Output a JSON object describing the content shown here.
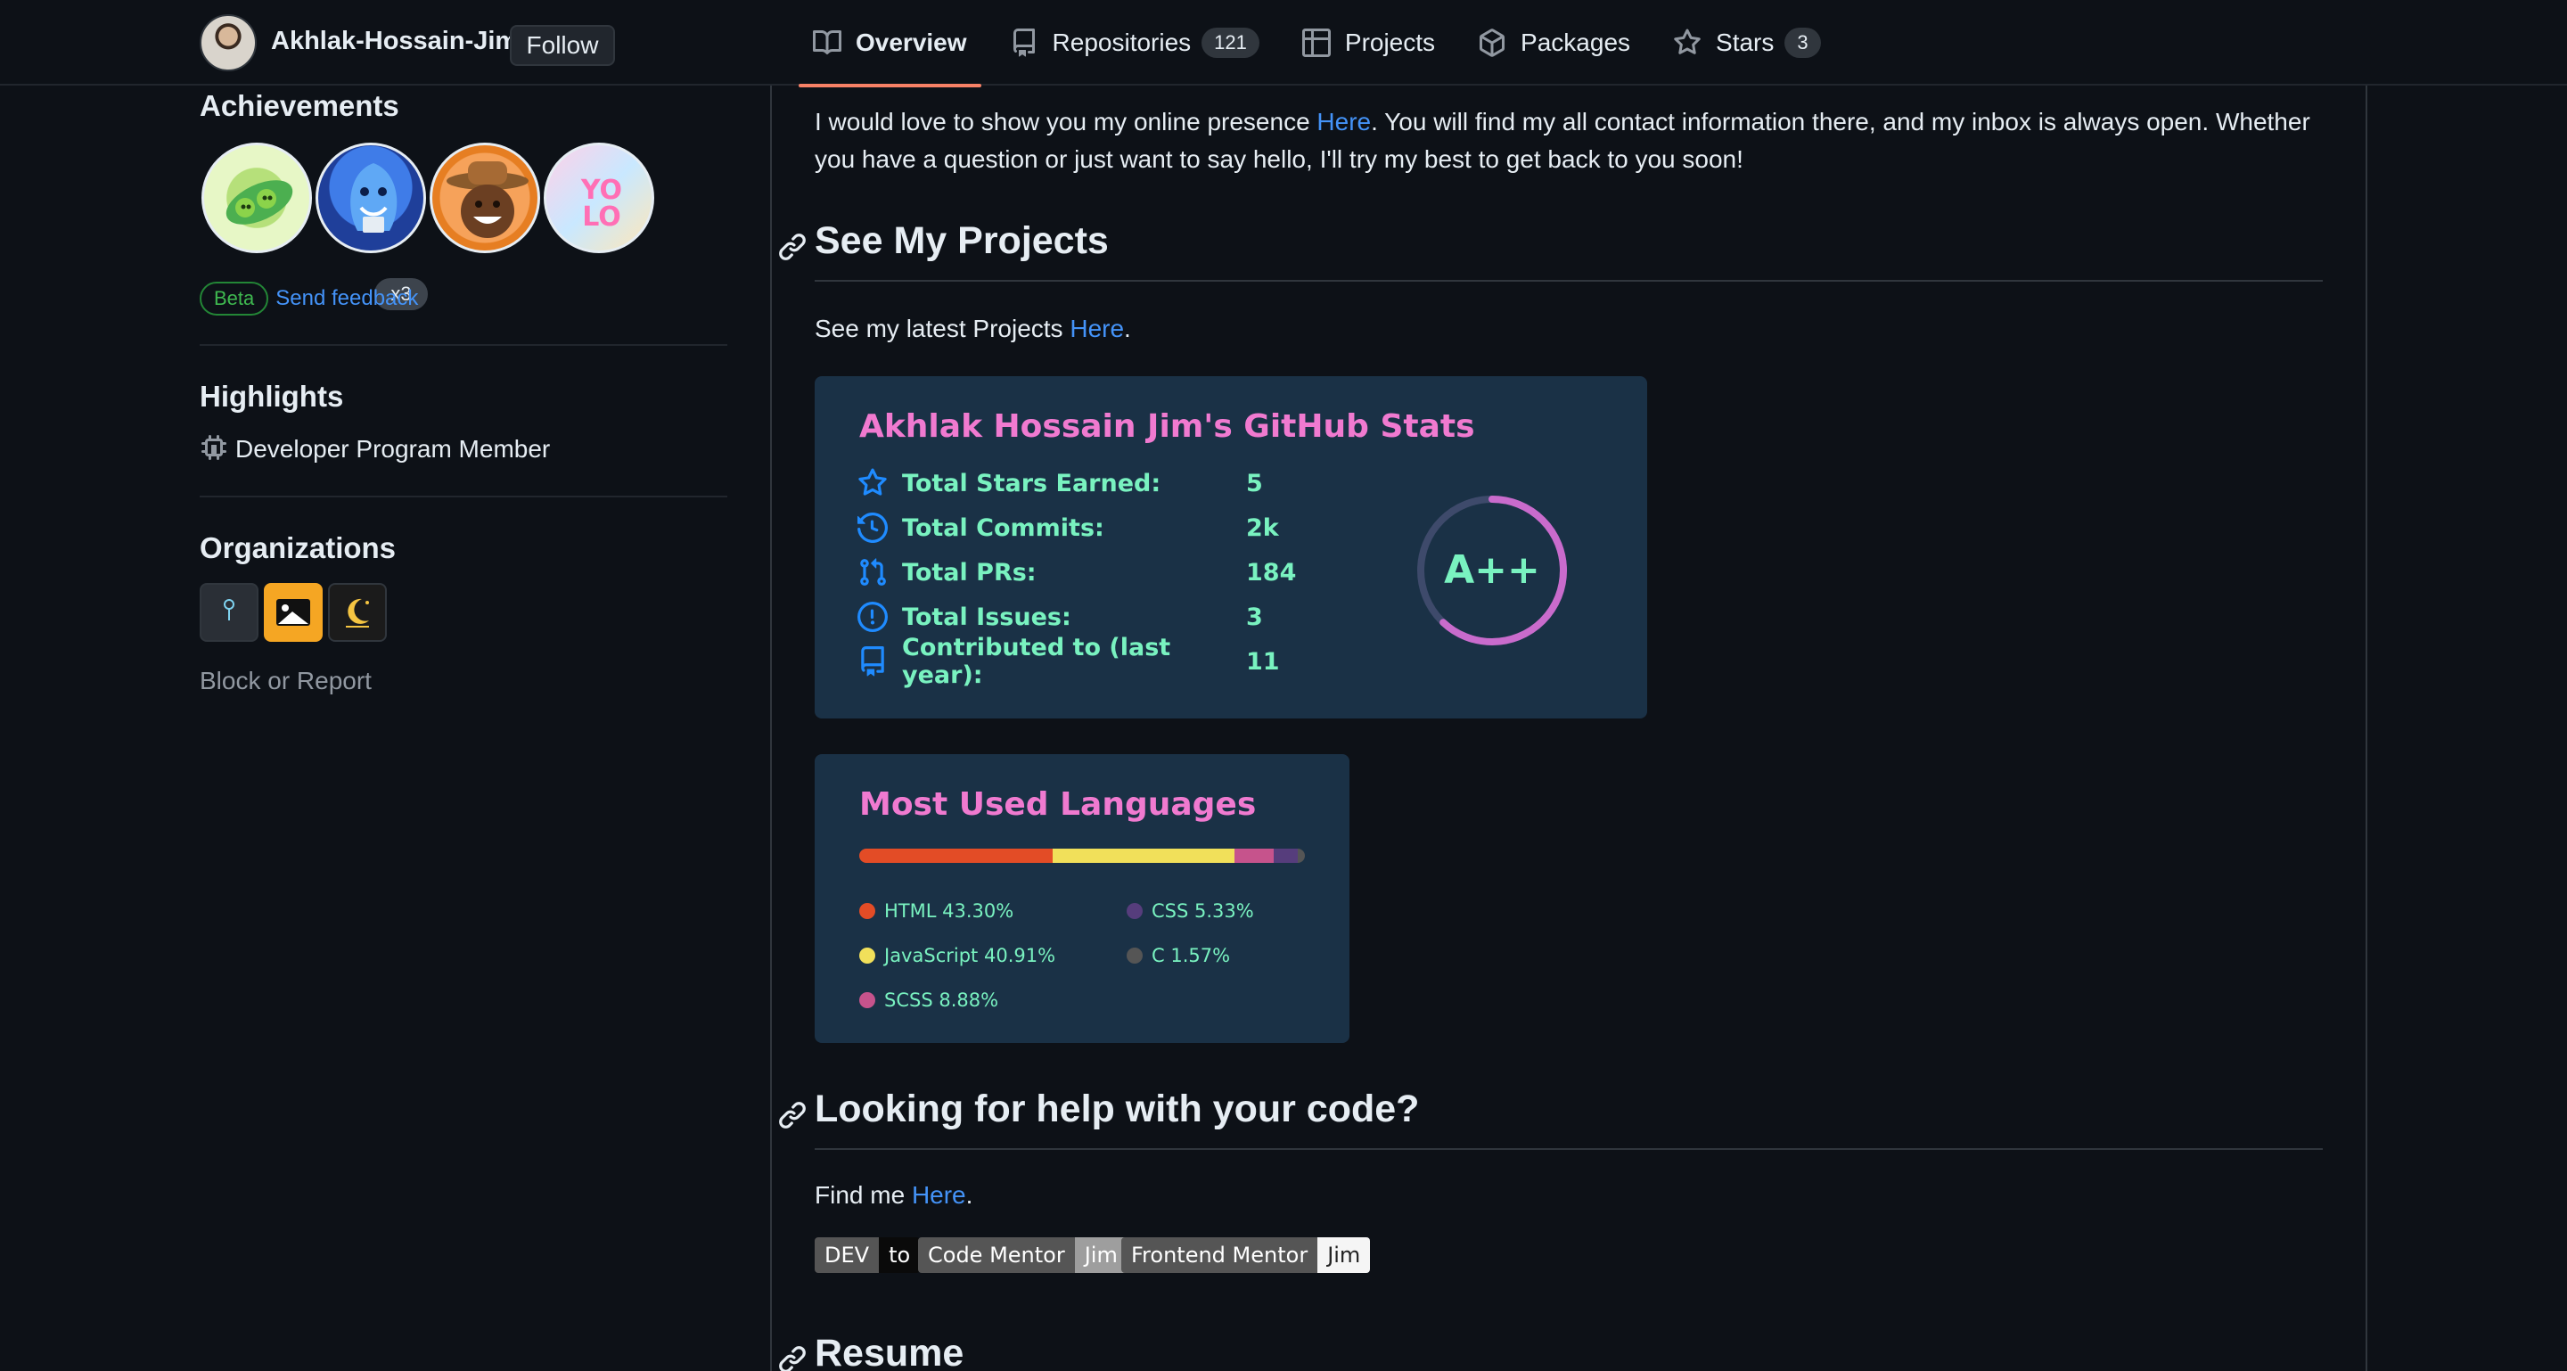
{
  "header": {
    "username": "Akhlak-Hossain-Jim",
    "follow_label": "Follow",
    "tabs": [
      {
        "label": "Overview",
        "icon": "book-icon",
        "active": true
      },
      {
        "label": "Repositories",
        "icon": "repo-icon",
        "count": "121"
      },
      {
        "label": "Projects",
        "icon": "table-icon"
      },
      {
        "label": "Packages",
        "icon": "package-icon"
      },
      {
        "label": "Stars",
        "icon": "star-icon",
        "count": "3"
      }
    ]
  },
  "sidebar": {
    "achievements_title": "Achievements",
    "achievement_multiplier": "x3",
    "beta_label": "Beta",
    "feedback_label": "Send feedback",
    "highlights_title": "Highlights",
    "highlight_item": "Developer Program Member",
    "organizations_title": "Organizations",
    "block_report": "Block or Report"
  },
  "main": {
    "intro_before": "I would love to show you my online presence ",
    "intro_link": "Here",
    "intro_after": ". You will find my all contact information there, and my inbox is always open. Whether you have a question or just want to say hello, I'll try my best to get back to you soon!",
    "projects_heading": "See My Projects",
    "projects_before": "See my latest Projects ",
    "projects_link": "Here",
    "projects_after": ".",
    "stats": {
      "title": "Akhlak Hossain Jim's GitHub Stats",
      "rows": [
        {
          "label": "Total Stars Earned:",
          "value": "5",
          "icon": "star-icon"
        },
        {
          "label": "Total Commits:",
          "value": "2k",
          "icon": "history-icon"
        },
        {
          "label": "Total PRs:",
          "value": "184",
          "icon": "pull-request-icon"
        },
        {
          "label": "Total Issues:",
          "value": "3",
          "icon": "issue-icon"
        },
        {
          "label": "Contributed to (last year):",
          "value": "11",
          "icon": "repo-icon"
        }
      ],
      "grade": "A++",
      "grade_progress": 0.62
    },
    "languages": {
      "title": "Most Used Languages",
      "items": [
        {
          "name": "HTML",
          "percent": "43.30%",
          "value": 43.3,
          "color": "#e34c26"
        },
        {
          "name": "JavaScript",
          "percent": "40.91%",
          "value": 40.91,
          "color": "#f1e05a"
        },
        {
          "name": "SCSS",
          "percent": "8.88%",
          "value": 8.88,
          "color": "#c6538c"
        },
        {
          "name": "CSS",
          "percent": "5.33%",
          "value": 5.33,
          "color": "#563d7c"
        },
        {
          "name": "C",
          "percent": "1.57%",
          "value": 1.57,
          "color": "#555555"
        }
      ]
    },
    "help_heading": "Looking for help with your code?",
    "find_before": "Find me ",
    "find_link": "Here",
    "find_after": ".",
    "shields": {
      "dev_left": "DEV",
      "dev_right": "to",
      "cm_left": "Code Mentor",
      "cm_right": "Jim",
      "fm_left": "Frontend Mentor",
      "fm_right": "Jim"
    },
    "resume_heading": "Resume"
  },
  "colors": {
    "accent_underline": "#f78166",
    "link": "#4493f8",
    "card_bg": "#1a3146",
    "card_title": "#f07ad0",
    "card_text": "#79f2c0"
  }
}
